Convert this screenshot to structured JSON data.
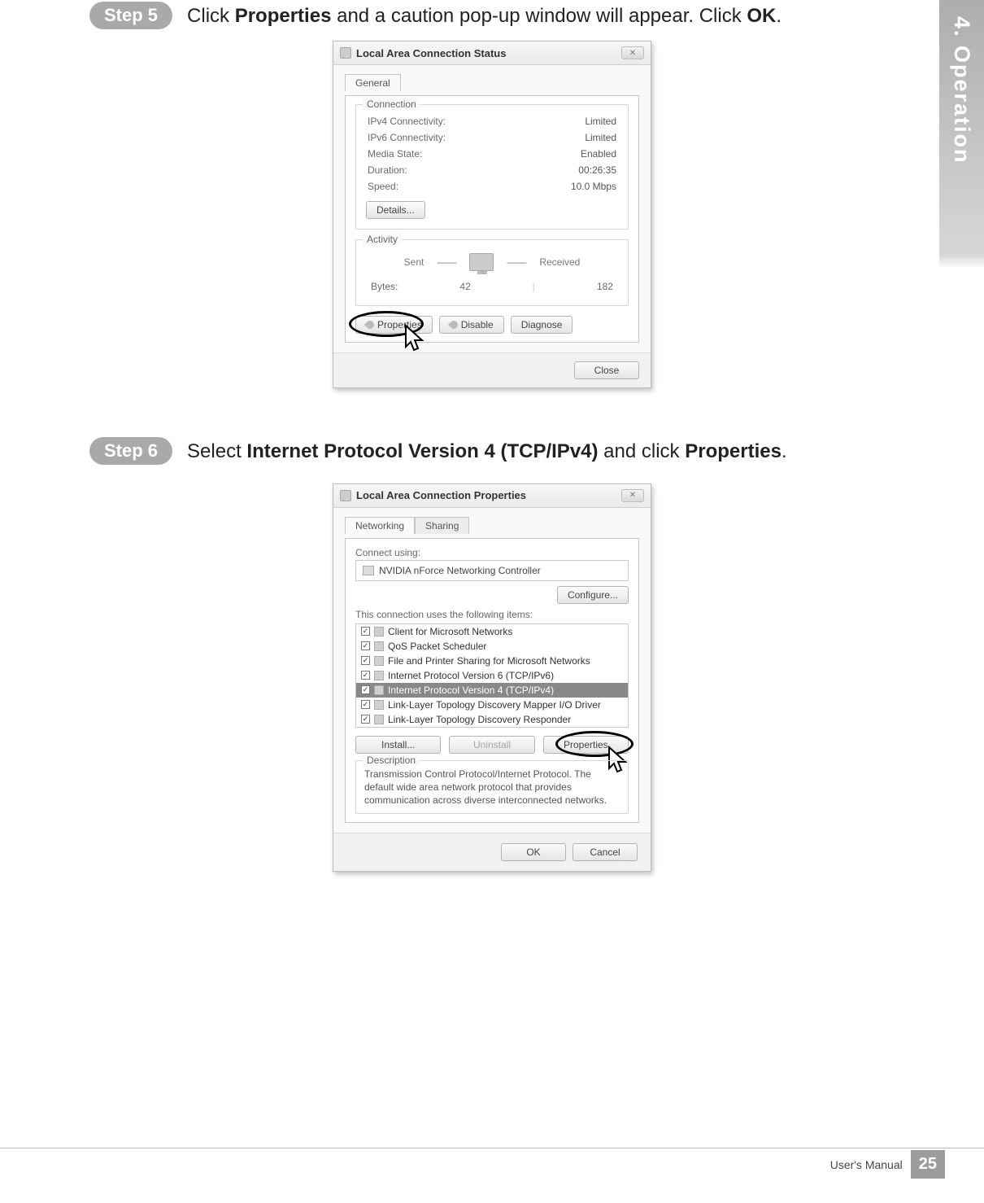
{
  "side_tab": "4. Operation",
  "step5": {
    "badge": "Step 5",
    "text_before": "Click ",
    "bold1": "Properties",
    "text_mid": " and a caution pop-up window will appear. Click ",
    "bold2": "OK",
    "text_after": "."
  },
  "dialog1": {
    "title": "Local Area Connection Status",
    "tab_general": "General",
    "group_connection": "Connection",
    "rows": {
      "ipv4_l": "IPv4 Connectivity:",
      "ipv4_v": "Limited",
      "ipv6_l": "IPv6 Connectivity:",
      "ipv6_v": "Limited",
      "media_l": "Media State:",
      "media_v": "Enabled",
      "dur_l": "Duration:",
      "dur_v": "00:26:35",
      "spd_l": "Speed:",
      "spd_v": "10.0 Mbps"
    },
    "details_btn": "Details...",
    "group_activity": "Activity",
    "sent": "Sent",
    "received": "Received",
    "bytes_label": "Bytes:",
    "bytes_sent": "42",
    "bytes_recv": "182",
    "properties_btn": "Properties",
    "disable_btn": "Disable",
    "diagnose_btn": "Diagnose",
    "close_btn": "Close"
  },
  "step6": {
    "badge": "Step 6",
    "text_before": "Select ",
    "bold1": "Internet Protocol Version 4 (TCP/IPv4)",
    "text_mid": " and click ",
    "bold2": "Properties",
    "text_after": "."
  },
  "dialog2": {
    "title": "Local Area Connection Properties",
    "tab_networking": "Networking",
    "tab_sharing": "Sharing",
    "connect_using": "Connect using:",
    "adapter": "NVIDIA nForce Networking Controller",
    "configure_btn": "Configure...",
    "items_label": "This connection uses the following items:",
    "items": [
      "Client for Microsoft Networks",
      "QoS Packet Scheduler",
      "File and Printer Sharing for Microsoft Networks",
      "Internet Protocol Version 6 (TCP/IPv6)",
      "Internet Protocol Version 4 (TCP/IPv4)",
      "Link-Layer Topology Discovery Mapper I/O Driver",
      "Link-Layer Topology Discovery Responder"
    ],
    "install_btn": "Install...",
    "uninstall_btn": "Uninstall",
    "properties_btn": "Properties",
    "desc_title": "Description",
    "desc_text": "Transmission Control Protocol/Internet Protocol. The default wide area network protocol that provides communication across diverse interconnected networks.",
    "ok_btn": "OK",
    "cancel_btn": "Cancel"
  },
  "footer": {
    "manual": "User's Manual",
    "page": "25"
  }
}
